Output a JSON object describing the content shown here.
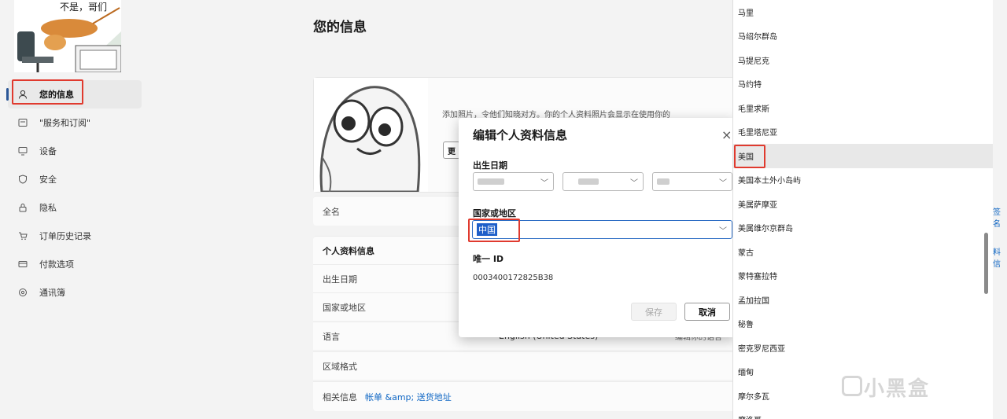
{
  "meme": {
    "text": "不是，哥们"
  },
  "sidebar": {
    "items": [
      {
        "label": "您的信息",
        "icon": "person-icon"
      },
      {
        "label": "\"服务和订阅\"",
        "icon": "subscription-icon"
      },
      {
        "label": "设备",
        "icon": "device-icon"
      },
      {
        "label": "安全",
        "icon": "shield-icon"
      },
      {
        "label": "隐私",
        "icon": "lock-icon"
      },
      {
        "label": "订单历史记录",
        "icon": "cart-icon"
      },
      {
        "label": "付款选项",
        "icon": "card-icon"
      },
      {
        "label": "通讯簿",
        "icon": "location-icon"
      }
    ]
  },
  "main": {
    "title": "您的信息",
    "add_photo_text": "添加照片，令他们知晓对方。你的个人资料照片会显示在使用你的",
    "change_button": "更",
    "fullname_label": "全名",
    "info_rows": [
      {
        "label": "个人资料信息",
        "value": "",
        "value2": ""
      },
      {
        "label": "出生日期",
        "value": "",
        "value2": ""
      },
      {
        "label": "国家或地区",
        "value": "",
        "value2": ""
      },
      {
        "label": "语言",
        "value": "English (United States)",
        "value2": "编辑你的语言"
      },
      {
        "label": "区域格式",
        "value": "",
        "value2": ""
      }
    ],
    "related_label": "相关信息",
    "related_link": "帐单 &amp; 送货地址",
    "right_edge_1": "签名",
    "right_edge_2": "料信"
  },
  "modal": {
    "title": "编辑个人资料信息",
    "close": "×",
    "birthdate_label": "出生日期",
    "country_label": "国家或地区",
    "country_value": "中国",
    "id_label": "唯一 ID",
    "id_value": "0003400172825B38",
    "save": "保存",
    "cancel": "取消"
  },
  "dropdown": {
    "items": [
      "马里",
      "马绍尔群岛",
      "马提尼克",
      "马约特",
      "毛里求斯",
      "毛里塔尼亚",
      "美国",
      "美国本土外小岛屿",
      "美属萨摩亚",
      "美属维尔京群岛",
      "蒙古",
      "蒙特塞拉特",
      "孟加拉国",
      "秘鲁",
      "密克罗尼西亚",
      "缅甸",
      "摩尔多瓦",
      "摩洛哥"
    ],
    "selected": "美国"
  },
  "watermark": "小黑盒"
}
